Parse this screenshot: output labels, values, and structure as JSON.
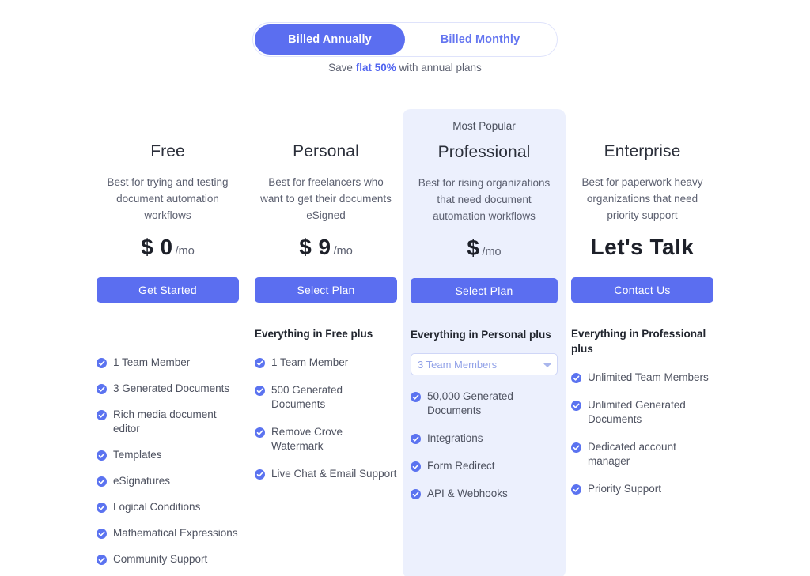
{
  "billing_toggle": {
    "annual_label": "Billed Annually",
    "monthly_label": "Billed Monthly",
    "active": "annual"
  },
  "save_note": {
    "prefix": "Save ",
    "highlight": "flat 50%",
    "suffix": " with annual plans"
  },
  "colors": {
    "accent": "#5b6ef0",
    "accent_text": "#6475f0",
    "featured_bg": "#ecf0fd",
    "check": "#5b73f0",
    "body_text": "#4e5260"
  },
  "plans": [
    {
      "badge": "",
      "name": "Free",
      "description": "Best for trying and testing document automation workflows",
      "price_main": "$ 0",
      "price_suffix": "/mo",
      "cta": "Get Started",
      "plus_heading": "",
      "select": null,
      "features": [
        "1 Team Member",
        "3 Generated Documents",
        "Rich media document editor",
        "Templates",
        "eSignatures",
        "Logical Conditions",
        "Mathematical Expressions",
        "Community Support"
      ]
    },
    {
      "badge": "",
      "name": "Personal",
      "description": "Best for freelancers who want to get their documents eSigned",
      "price_main": "$ 9",
      "price_suffix": "/mo",
      "cta": "Select Plan",
      "plus_heading": "Everything in Free plus",
      "select": null,
      "features": [
        "1 Team Member",
        "500 Generated Documents",
        "Remove Crove Watermark",
        "Live Chat & Email Support"
      ]
    },
    {
      "badge": "Most Popular",
      "name": "Professional",
      "description": "Best for rising organizations that need document automation workflows",
      "price_main": "$",
      "price_suffix": "/mo",
      "cta": "Select Plan",
      "plus_heading": "Everything in Personal plus",
      "select": {
        "value": "3 Team Members",
        "options": [
          "3 Team Members"
        ]
      },
      "features": [
        "50,000 Generated Documents",
        "Integrations",
        "Form Redirect",
        "API & Webhooks"
      ]
    },
    {
      "badge": "",
      "name": "Enterprise",
      "description": "Best for paperwork heavy organizations that need priority support",
      "price_main": "Let's Talk",
      "price_suffix": "",
      "cta": "Contact Us",
      "plus_heading": "Everything in Professional plus",
      "select": null,
      "features": [
        "Unlimited Team Members",
        "Unlimited Generated Documents",
        "Dedicated account manager",
        "Priority Support"
      ]
    }
  ]
}
